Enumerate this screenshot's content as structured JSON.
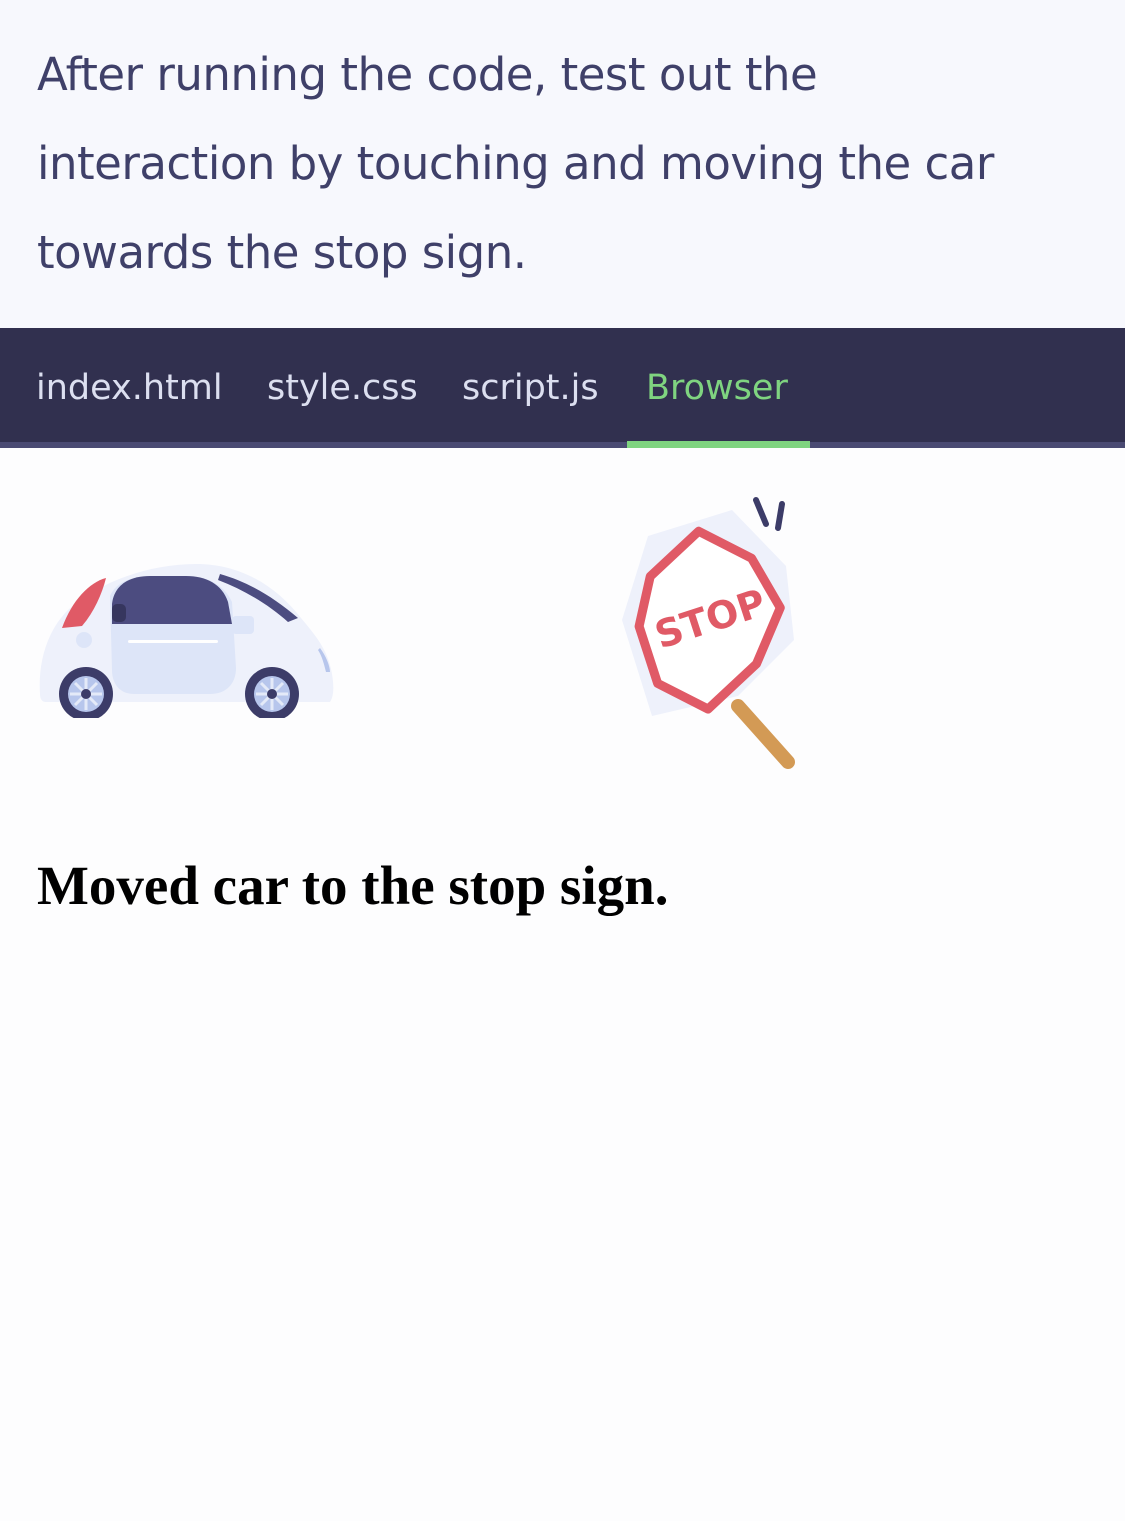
{
  "instructions": {
    "line1": "After running the code, test out the",
    "line2": "interaction by touching and moving the car",
    "line3": "towards the stop sign."
  },
  "tabs": [
    {
      "label": "index.html",
      "active": false
    },
    {
      "label": "style.css",
      "active": false
    },
    {
      "label": "script.js",
      "active": false
    },
    {
      "label": "Browser",
      "active": true
    }
  ],
  "browser": {
    "stop_sign_text": "STOP",
    "status_message": "Moved car to the stop sign."
  },
  "icons": {
    "car": "car-icon",
    "stop_sign": "stop-sign-icon"
  },
  "colors": {
    "instruction_text": "#3f4069",
    "tabbar_background": "#31304f",
    "tab_text": "#dcdff0",
    "tab_active": "#7fd480",
    "stop_sign_red": "#e05a66",
    "car_window": "#4a4a7a"
  }
}
